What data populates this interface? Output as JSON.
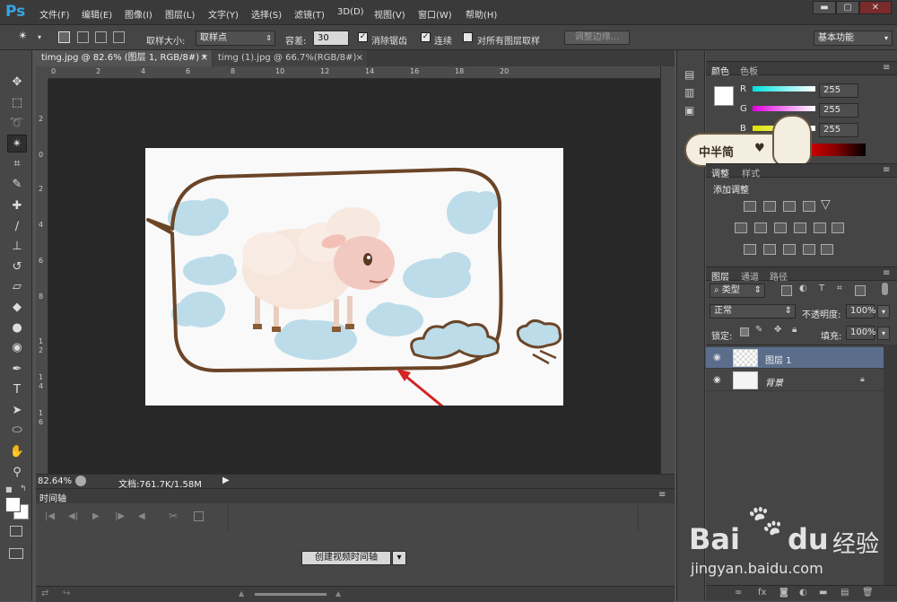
{
  "app": {
    "logo": "Ps"
  },
  "menu": [
    "文件(F)",
    "编辑(E)",
    "图像(I)",
    "图层(L)",
    "文字(Y)",
    "选择(S)",
    "滤镜(T)",
    "3D(D)",
    "视图(V)",
    "窗口(W)",
    "帮助(H)"
  ],
  "window_controls": {
    "minimize": "▬",
    "maximize": "▢",
    "close": "✕"
  },
  "options": {
    "sample_size_label": "取样大小:",
    "sample_size_value": "取样点",
    "tolerance_label": "容差:",
    "tolerance_value": "30",
    "antialias_label": "消除锯齿",
    "contiguous_label": "连续",
    "all_layers_label": "对所有图层取样",
    "refine_edge_label": "调整边缘...",
    "workspace": "基本功能"
  },
  "doc_tabs": [
    {
      "title": "timg.jpg @ 82.6% (图层 1, RGB/8#) *",
      "close": "×"
    },
    {
      "title": "timg (1).jpg @ 66.7%(RGB/8#)",
      "close": "×"
    }
  ],
  "ruler_h": [
    "0",
    "2",
    "4",
    "6",
    "8",
    "10",
    "12",
    "14",
    "16",
    "18",
    "20"
  ],
  "ruler_v": [
    "2",
    "0",
    "2",
    "4",
    "6",
    "8",
    "1",
    "2",
    "1",
    "4",
    "1",
    "6"
  ],
  "status": {
    "zoom": "82.64%",
    "doc": "文档:761.7K/1.58M"
  },
  "timeline": {
    "tab": "时间轴",
    "create_button": "创建视频时间轴"
  },
  "color_panel": {
    "tabs": [
      "颜色",
      "色板"
    ],
    "channels": [
      {
        "label": "R",
        "value": "255"
      },
      {
        "label": "G",
        "value": "255"
      },
      {
        "label": "B",
        "value": "255"
      }
    ]
  },
  "adjustments_panel": {
    "tabs": [
      "调整",
      "样式"
    ],
    "title": "添加调整"
  },
  "layers_panel": {
    "tabs": [
      "图层",
      "通道",
      "路径"
    ],
    "filter_type": "类型",
    "blend_mode": "正常",
    "opacity_label": "不透明度:",
    "opacity_value": "100%",
    "lock_label": "锁定:",
    "fill_label": "填充:",
    "fill_value": "100%",
    "layers": [
      {
        "name": "图层 1",
        "selected": true
      },
      {
        "name": "背景",
        "selected": false
      }
    ]
  },
  "sticker": {
    "text": "中半简"
  },
  "watermark": {
    "brand_a": "Bai",
    "brand_b": "du",
    "brand_cn": "经验",
    "url": "jingyan.baidu.com"
  },
  "colors": {
    "accent_blue": "#35a4e6",
    "selected_layer": "#5a6e8c",
    "arrow_red": "#d42424",
    "cloud_blue": "#bcdcea"
  }
}
